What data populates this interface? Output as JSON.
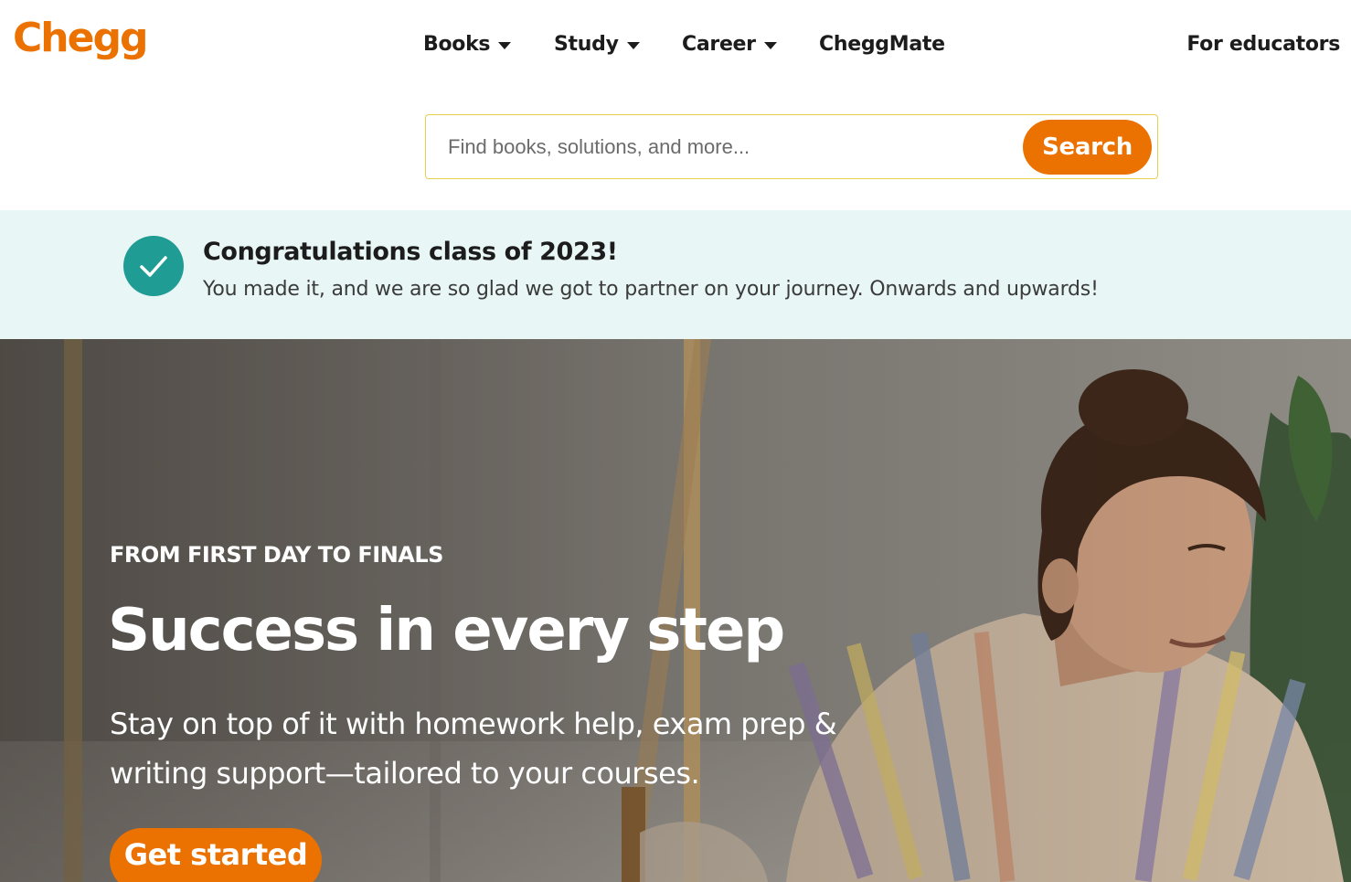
{
  "header": {
    "logo": "Chegg",
    "nav": [
      {
        "label": "Books",
        "dropdown": true
      },
      {
        "label": "Study",
        "dropdown": true
      },
      {
        "label": "Career",
        "dropdown": true
      },
      {
        "label": "CheggMate",
        "dropdown": false
      }
    ],
    "for_educators": "For educators"
  },
  "search": {
    "placeholder": "Find books, solutions, and more...",
    "button": "Search"
  },
  "banner": {
    "title": "Congratulations class of 2023!",
    "text": "You made it, and we are so glad we got to partner on your journey. Onwards and upwards!",
    "icon": "check-circle-icon"
  },
  "hero": {
    "eyebrow": "FROM FIRST DAY TO FINALS",
    "title": "Success in every step",
    "subtitle": "Stay on top of it with homework help, exam prep & writing support—tailored to your courses.",
    "cta": "Get started"
  },
  "colors": {
    "brand_orange": "#eb7100",
    "banner_bg": "#e8f6f6",
    "check_teal": "#1f9c94",
    "search_border": "#e5cf4f"
  }
}
